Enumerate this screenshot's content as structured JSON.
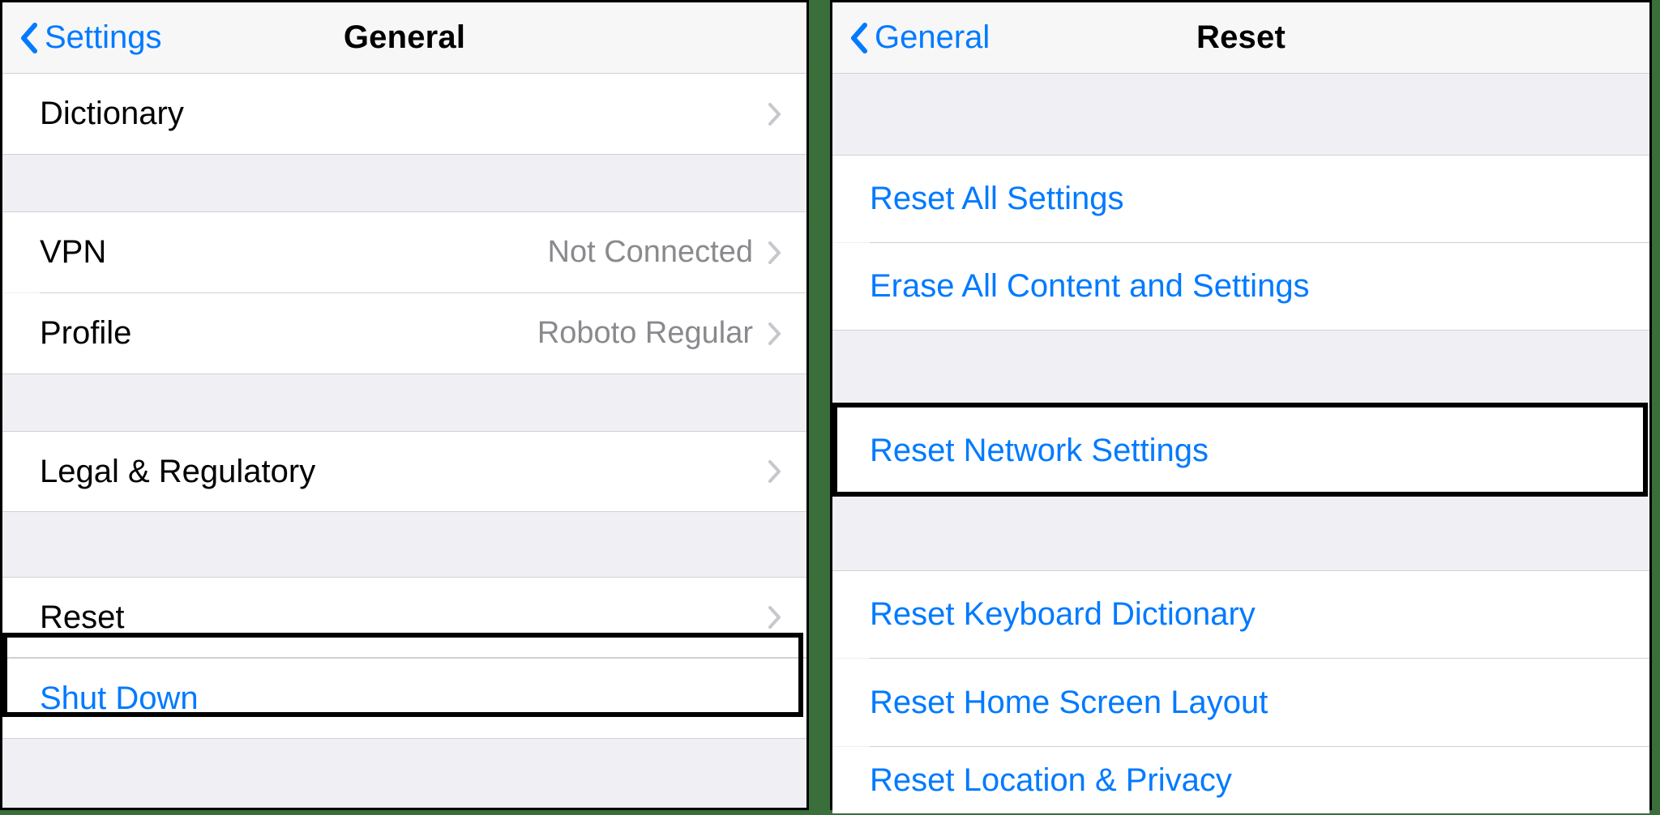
{
  "left": {
    "back_label": "Settings",
    "title": "General",
    "groups": [
      {
        "items": [
          {
            "key": "dictionary",
            "label": "Dictionary",
            "value": "",
            "chevron": true
          }
        ]
      },
      {
        "items": [
          {
            "key": "vpn",
            "label": "VPN",
            "value": "Not Connected",
            "chevron": true
          },
          {
            "key": "profile",
            "label": "Profile",
            "value": "Roboto Regular",
            "chevron": true
          }
        ]
      },
      {
        "items": [
          {
            "key": "legal",
            "label": "Legal & Regulatory",
            "value": "",
            "chevron": true
          }
        ]
      },
      {
        "items": [
          {
            "key": "reset",
            "label": "Reset",
            "value": "",
            "chevron": true,
            "highlighted": true
          }
        ]
      },
      {
        "items": [
          {
            "key": "shutdown",
            "label": "Shut Down",
            "value": "",
            "chevron": false,
            "style": "action"
          }
        ]
      }
    ]
  },
  "right": {
    "back_label": "General",
    "title": "Reset",
    "groups": [
      {
        "items": [
          {
            "key": "reset-all",
            "label": "Reset All Settings",
            "style": "action"
          },
          {
            "key": "erase-all",
            "label": "Erase All Content and Settings",
            "style": "action"
          }
        ]
      },
      {
        "items": [
          {
            "key": "reset-network",
            "label": "Reset Network Settings",
            "style": "action",
            "highlighted": true
          }
        ]
      },
      {
        "items": [
          {
            "key": "reset-keyboard",
            "label": "Reset Keyboard Dictionary",
            "style": "action"
          },
          {
            "key": "reset-home",
            "label": "Reset Home Screen Layout",
            "style": "action"
          },
          {
            "key": "reset-location",
            "label": "Reset Location & Privacy",
            "style": "action"
          }
        ]
      }
    ]
  }
}
